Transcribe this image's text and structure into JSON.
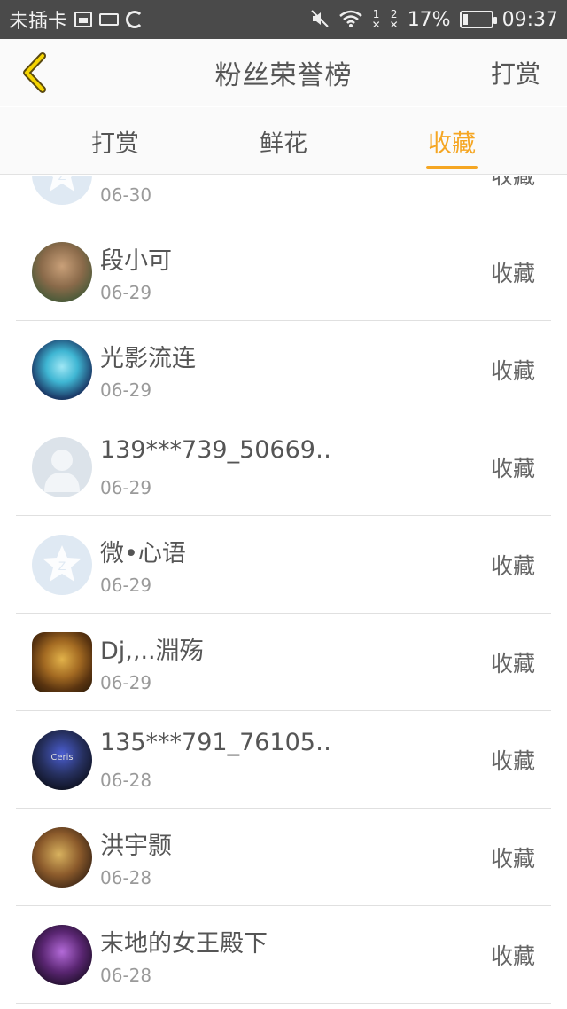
{
  "status_bar": {
    "carrier": "未插卡",
    "sim1": "1",
    "sim2": "2",
    "battery_percent": "17%",
    "battery_level": 0.17,
    "time": "09:37"
  },
  "nav": {
    "title": "粉丝荣誉榜",
    "right_action": "打赏"
  },
  "tabs": [
    {
      "label": "打赏",
      "active": false
    },
    {
      "label": "鲜花",
      "active": false
    },
    {
      "label": "收藏",
      "active": true
    }
  ],
  "accent_color": "#f5a623",
  "list": [
    {
      "name": "",
      "date": "06-30",
      "action": "收藏",
      "avatar": "qq-default-avatar"
    },
    {
      "name": "段小可",
      "date": "06-29",
      "action": "收藏",
      "avatar": "photo-avatar"
    },
    {
      "name": "光影流连",
      "date": "06-29",
      "action": "收藏",
      "avatar": "anime-avatar"
    },
    {
      "name": "139***739_50669…",
      "date": "06-29",
      "action": "收藏",
      "avatar": "default-person-avatar"
    },
    {
      "name": "微•心语",
      "date": "06-29",
      "action": "收藏",
      "avatar": "qq-default-avatar"
    },
    {
      "name": "Dj,,..淵殇",
      "date": "06-29",
      "action": "收藏",
      "avatar": "monster-avatar"
    },
    {
      "name": "135***791_76105…",
      "date": "06-28",
      "action": "收藏",
      "avatar": "dark-avatar",
      "avatar_text": "Ceris"
    },
    {
      "name": "洪宇颢",
      "date": "06-28",
      "action": "收藏",
      "avatar": "warm-avatar"
    },
    {
      "name": "末地的女王殿下",
      "date": "06-28",
      "action": "收藏",
      "avatar": "purple-avatar"
    }
  ]
}
